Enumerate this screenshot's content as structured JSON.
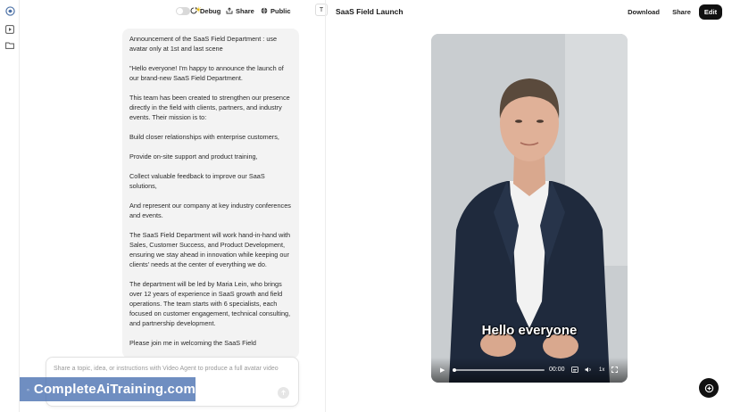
{
  "topbar": {
    "debug_label": "Debug",
    "share_label": "Share",
    "public_label": "Public",
    "t_label": "T"
  },
  "message": {
    "paragraphs": [
      "Announcement of the SaaS Field Department : use avatar only at 1st and last scene",
      "\"Hello everyone! I'm happy to announce the launch of our brand-new SaaS Field Department.",
      "This team has been created to strengthen our presence directly in the field with clients, partners, and industry events. Their mission is to:",
      "Build closer relationships with enterprise customers,",
      "Provide on-site support and product training,",
      "Collect valuable feedback to improve our SaaS solutions,",
      "And represent our company at key industry conferences and events.",
      "The SaaS Field Department will work hand-in-hand with Sales, Customer Success, and Product Development, ensuring we stay ahead in innovation while keeping our clients' needs at the center of everything we do.",
      "The department will be led by Maria Lein, who brings over 12 years of experience in SaaS growth and field operations. The team starts with 6 specialists, each focused on customer engagement, technical consulting, and partnership development.",
      "Please join me in welcoming the SaaS Field"
    ]
  },
  "composer": {
    "placeholder": "Share a topic, idea, or instructions with Video Agent to produce a full avatar video"
  },
  "watermark": {
    "text": "CompleteAiTraining.com"
  },
  "preview": {
    "title": "SaaS Field Launch",
    "download_label": "Download",
    "share_label": "Share",
    "edit_label": "Edit",
    "caption": "Hello everyone",
    "time": "00:00",
    "speed": "1x",
    "progress": 0
  },
  "colors": {
    "accent": "#111111",
    "watermark_bg": "#466eaf",
    "bubble_bg": "#f3f3f3"
  }
}
